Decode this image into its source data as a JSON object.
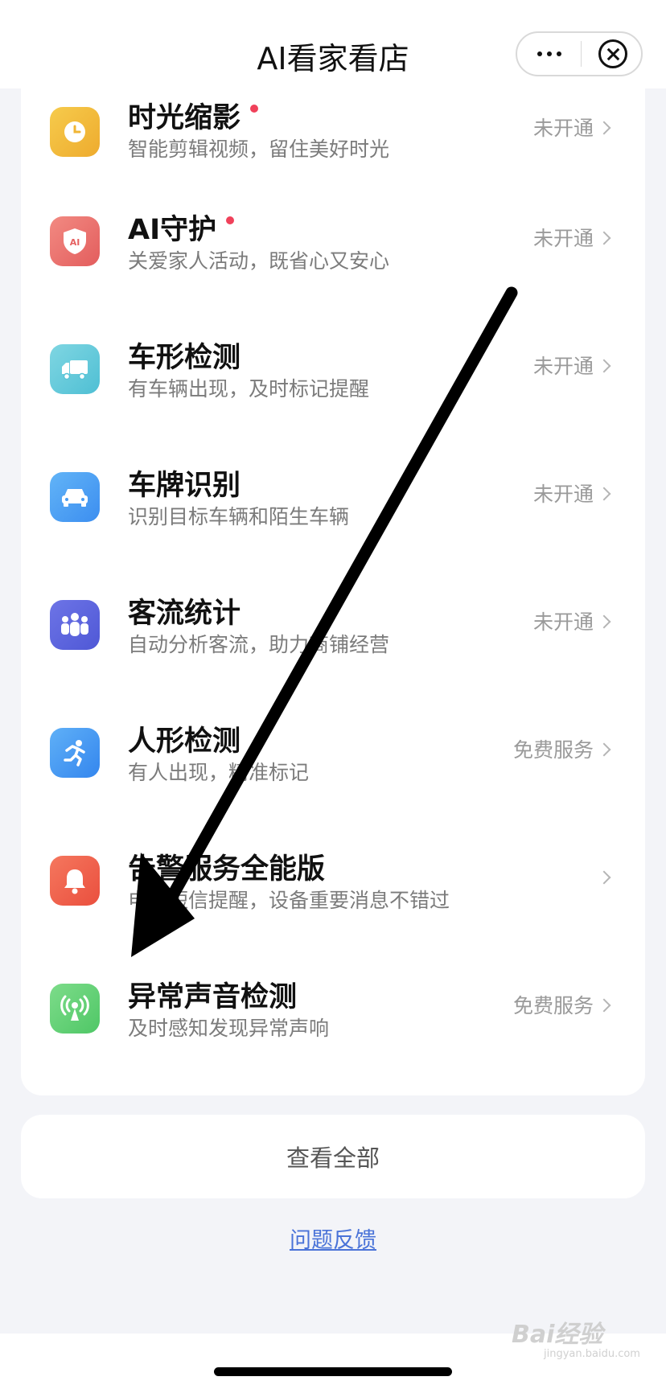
{
  "header": {
    "title": "AI看家看店"
  },
  "features": [
    {
      "title": "时光缩影",
      "subtitle": "智能剪辑视频，留住美好时光",
      "status": "未开通",
      "has_dot": true,
      "icon": "clock-icon",
      "icon_color": "#f2b935"
    },
    {
      "title": "AI守护",
      "subtitle": "关爱家人活动，既省心又安心",
      "status": "未开通",
      "has_dot": true,
      "icon": "shield-ai-icon",
      "icon_color": "#ef6b6b"
    },
    {
      "title": "车形检测",
      "subtitle": "有车辆出现，及时标记提醒",
      "status": "未开通",
      "has_dot": false,
      "icon": "truck-icon",
      "icon_color": "#5ec7d8"
    },
    {
      "title": "车牌识别",
      "subtitle": "识别目标车辆和陌生车辆",
      "status": "未开通",
      "has_dot": false,
      "icon": "car-icon",
      "icon_color": "#4a9cf2"
    },
    {
      "title": "客流统计",
      "subtitle": "自动分析客流，助力商铺经营",
      "status": "未开通",
      "has_dot": false,
      "icon": "people-icon",
      "icon_color": "#5a63de"
    },
    {
      "title": "人形检测",
      "subtitle": "有人出现，精准标记",
      "status": "免费服务",
      "has_dot": false,
      "icon": "running-person-icon",
      "icon_color": "#3e9bf0"
    },
    {
      "title": "告警服务全能版",
      "subtitle": "电话短信提醒，设备重要消息不错过",
      "status": "",
      "has_dot": false,
      "icon": "bell-icon",
      "icon_color": "#f0604a"
    },
    {
      "title": "异常声音检测",
      "subtitle": "及时感知发现异常声响",
      "status": "免费服务",
      "has_dot": false,
      "icon": "sound-broadcast-icon",
      "icon_color": "#5cd06e"
    }
  ],
  "view_all_label": "查看全部",
  "feedback_label": "问题反馈",
  "watermark": {
    "main": "Bai经验",
    "sub": "jingyan.baidu.com"
  }
}
